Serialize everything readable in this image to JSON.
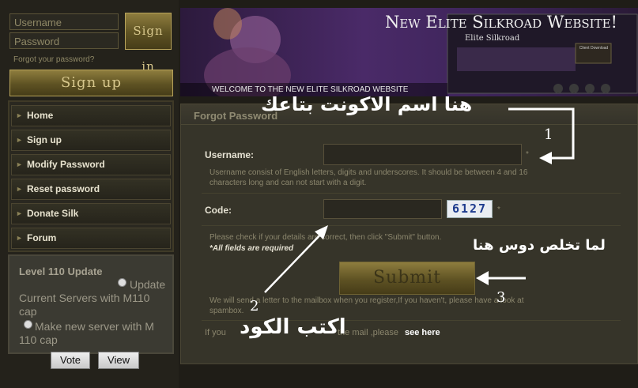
{
  "login": {
    "username_placeholder": "Username",
    "password_placeholder": "Password",
    "signin_label": "Sign in",
    "forgot_link": "Forgot your password?",
    "signup_label": "Sign up"
  },
  "nav": {
    "items": [
      {
        "label": "Home"
      },
      {
        "label": "Sign up"
      },
      {
        "label": "Modify Password"
      },
      {
        "label": "Reset password"
      },
      {
        "label": "Donate Silk"
      },
      {
        "label": "Forum"
      }
    ]
  },
  "poll": {
    "title": "Level 110 Update",
    "option1_label": "Update",
    "option1_text": "Current Servers with M110 cap",
    "option2_text": "Make new server with M 110 cap",
    "vote_label": "Vote",
    "view_label": "View"
  },
  "banner": {
    "title": "New Elite Silkroad Website!",
    "subtitle": "WELCOME TO THE NEW ELITE SILKROAD WEBSITE",
    "thumb_title": "Elite Silkroad",
    "thumb_download": "Client Download"
  },
  "form": {
    "heading": "Forgot Password",
    "username_label": "Username:",
    "username_hint": "Username consist of English letters, digits and underscores. It should be between 4 and 16 characters long and can not start with a digit.",
    "required_star": "*",
    "code_label": "Code:",
    "captcha_text": "6127",
    "check_note": "Please check if your details are correct, then click \"Submit\" button.",
    "required_note": "*All fields are required",
    "submit_label": "Submit",
    "mail_note": "We will send a letter to the mailbox when you register,If you haven't, please have a look at spambox.",
    "footer_prefix": "If you",
    "footer_mid": "the mail ,please",
    "footer_link": "see here"
  },
  "annotations": {
    "note_username": "هنا اسم الاكونت بتاعك",
    "note_code": "اكتب الكود",
    "note_submit": "لما تخلص دوس هنا",
    "num1": "1",
    "num2": "2",
    "num3": "3",
    "color": "#ffffff"
  },
  "colors": {
    "gold": "#8e7d3e",
    "panel": "#363429",
    "background": "#1f1d17"
  }
}
